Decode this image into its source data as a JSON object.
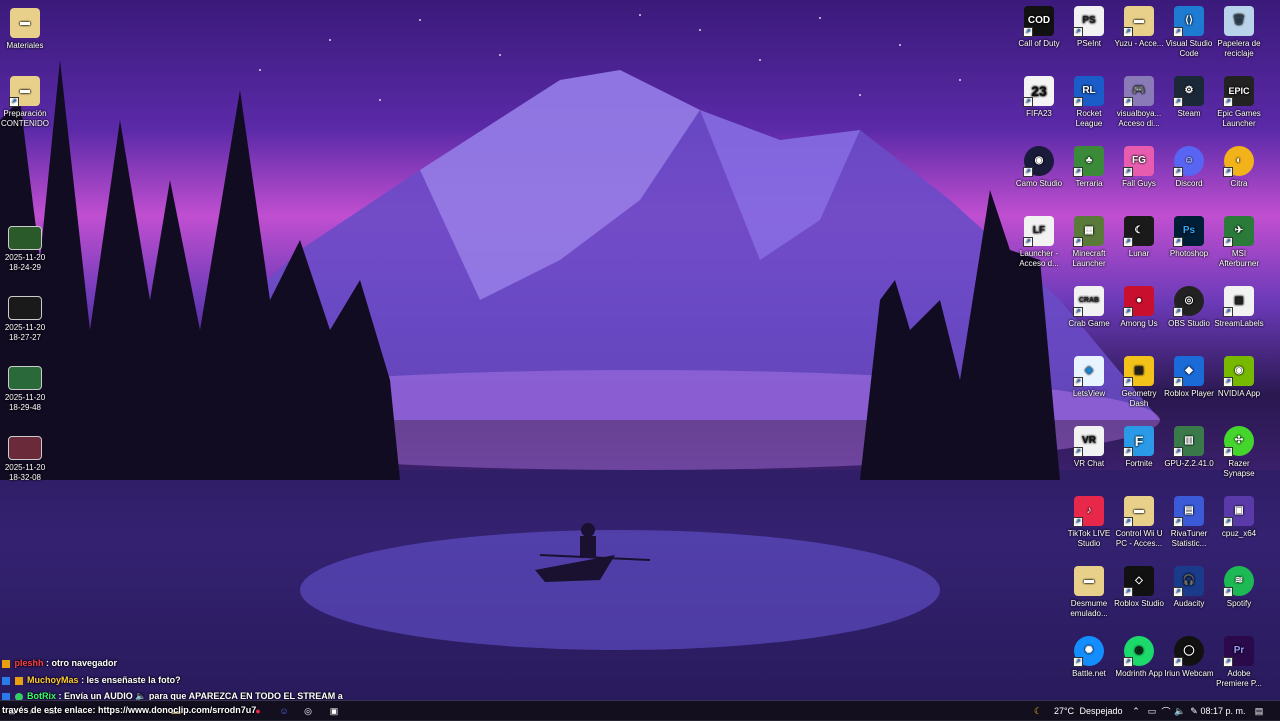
{
  "desktop_left": {
    "materiales": "Materiales",
    "preparacion": "Preparación CONTENIDO",
    "videos": [
      {
        "date": "2025-11-20",
        "time": "18-24-29"
      },
      {
        "date": "2025-11-20",
        "time": "18-27-27"
      },
      {
        "date": "2025-11-20",
        "time": "18-29-48"
      },
      {
        "date": "2025-11-20",
        "time": "18-32-08"
      }
    ]
  },
  "desktop_right": [
    [
      "Call of Duty",
      "PSeInt",
      "Yuzu - Acce...",
      "Visual Studio Code",
      "Papelera de reciclaje"
    ],
    [
      "FIFA23",
      "Rocket League",
      "visualboya... Acceso di...",
      "Steam",
      "Epic Games Launcher"
    ],
    [
      "Camo Studio",
      "Terraria",
      "Fall Guys",
      "Discord",
      "Citra"
    ],
    [
      "Launcher - Acceso d...",
      "Minecraft Launcher",
      "Lunar",
      "Photoshop",
      "MSI Afterburner"
    ],
    [
      "Crab Game",
      "Among Us",
      "OBS Studio",
      "StreamLabels"
    ],
    [
      "LetsView",
      "Geometry Dash",
      "Roblox Player",
      "NVIDIA App"
    ],
    [
      "VR Chat",
      "Fortnite",
      "GPU-Z.2.41.0",
      "Razer Synapse"
    ],
    [
      "TikTok LIVE Studio",
      "Control Wii U PC - Acces...",
      "RivaTuner Statistic...",
      "cpuz_x64"
    ],
    [
      "Desmume emulado...",
      "Roblox Studio",
      "Audacity",
      "Spotify"
    ],
    [
      "Battle.net",
      "Modrinth App",
      "Iriun Webcam",
      "Adobe Premiere P..."
    ]
  ],
  "chat": [
    {
      "user": "pleshh",
      "msg": ": otro navegador",
      "color": "#ff4040"
    },
    {
      "user": "MuchoyMas",
      "msg": ": les enseñaste la foto?",
      "color": "#ffcc33"
    },
    {
      "user": "BotRix",
      "msg": ": Envía un AUDIO 🔈 para que APAREZCA EN TODO EL STREAM a",
      "color": "#33ff66"
    },
    {
      "user": "",
      "msg": "través de este enlace: https://www.donoclip.com/srrodn7u7",
      "color": "#ffffff"
    }
  ],
  "taskbar": {
    "weather_temp": "27°C",
    "weather_desc": "Despejado",
    "time": "08:17 p. m."
  },
  "colors": {
    "taskbar_bg": "#14101e",
    "accent": "#7a4bd8"
  }
}
